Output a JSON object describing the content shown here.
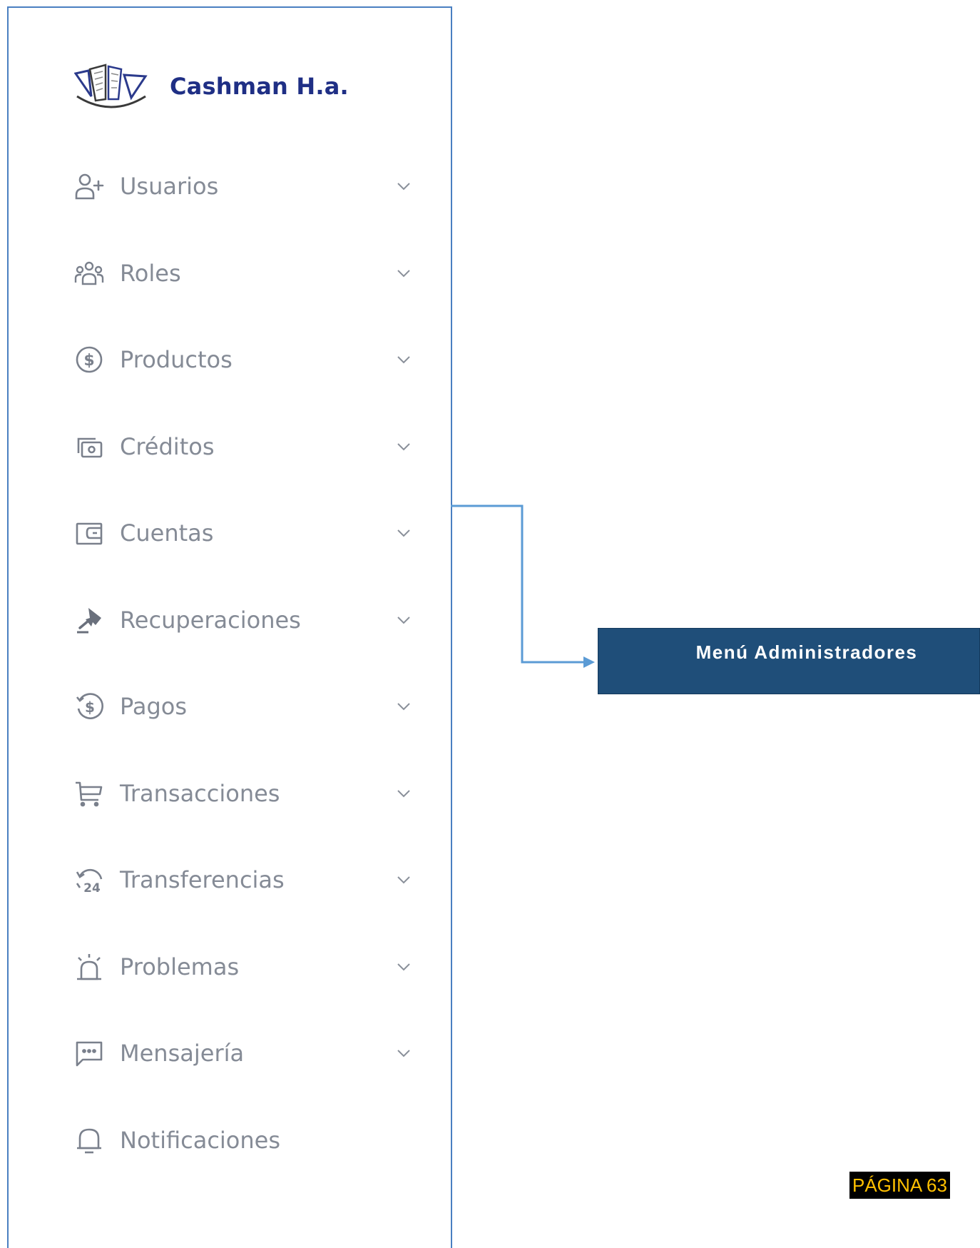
{
  "sidebar": {
    "brand": "Cashman H.a.",
    "logo_icon": "building-books-logo",
    "items": [
      {
        "label": "Usuarios",
        "icon": "user-plus-icon",
        "has_chevron": true
      },
      {
        "label": "Roles",
        "icon": "users-group-icon",
        "has_chevron": true
      },
      {
        "label": "Productos",
        "icon": "dollar-circle-icon",
        "has_chevron": true
      },
      {
        "label": "Créditos",
        "icon": "money-stack-icon",
        "has_chevron": true
      },
      {
        "label": "Cuentas",
        "icon": "wallet-icon",
        "has_chevron": true
      },
      {
        "label": "Recuperaciones",
        "icon": "gavel-icon",
        "has_chevron": true
      },
      {
        "label": "Pagos",
        "icon": "dollar-refresh-icon",
        "has_chevron": true
      },
      {
        "label": "Transacciones",
        "icon": "cart-icon",
        "has_chevron": true
      },
      {
        "label": "Transferencias",
        "icon": "clock-24-icon",
        "has_chevron": true
      },
      {
        "label": "Problemas",
        "icon": "alarm-siren-icon",
        "has_chevron": true
      },
      {
        "label": "Mensajería",
        "icon": "message-dots-icon",
        "has_chevron": true
      },
      {
        "label": "Notificaciones",
        "icon": "bell-icon",
        "has_chevron": false
      }
    ]
  },
  "callout": {
    "label": "Menú Administradores"
  },
  "footer": {
    "page_label": "PÁGINA 63"
  },
  "colors": {
    "border": "#4a7fc1",
    "brand": "#1f2f85",
    "menu_text": "#858b96",
    "callout_bg": "#1f4e79",
    "page_bg": "#000000",
    "page_text": "#ffc000"
  }
}
